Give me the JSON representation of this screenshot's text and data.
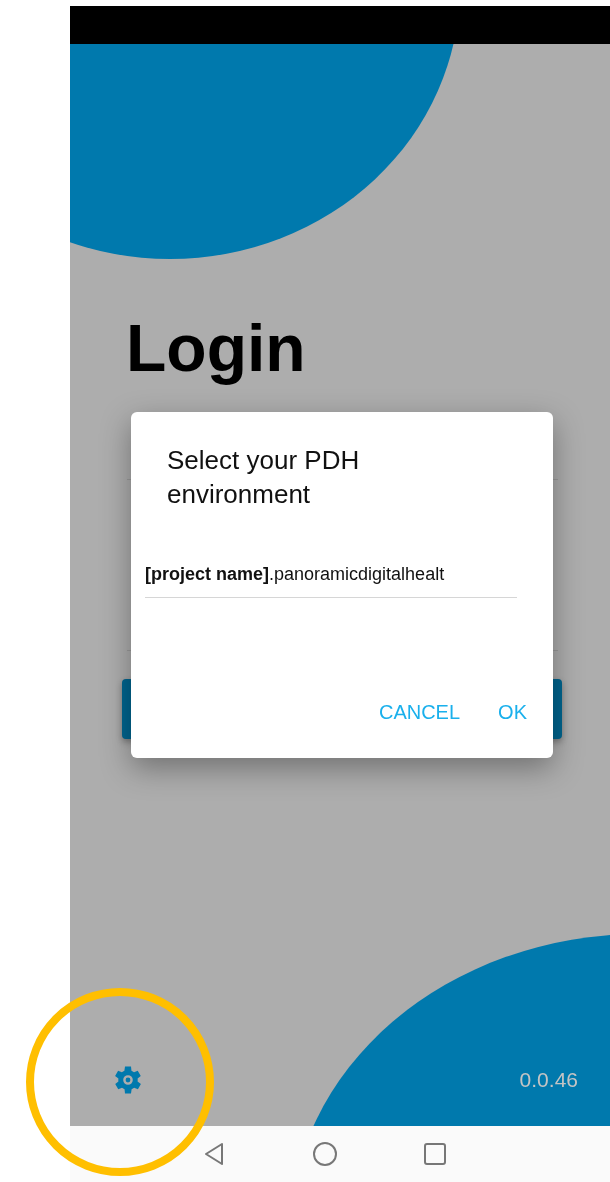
{
  "screen": {
    "heading": "Login",
    "version": "0.0.46"
  },
  "dialog": {
    "title": "Select your PDH environment",
    "field": {
      "value": "**[project name]**.panoramicdigitalhealt"
    },
    "buttons": [
      "CANCEL",
      "OK"
    ]
  }
}
